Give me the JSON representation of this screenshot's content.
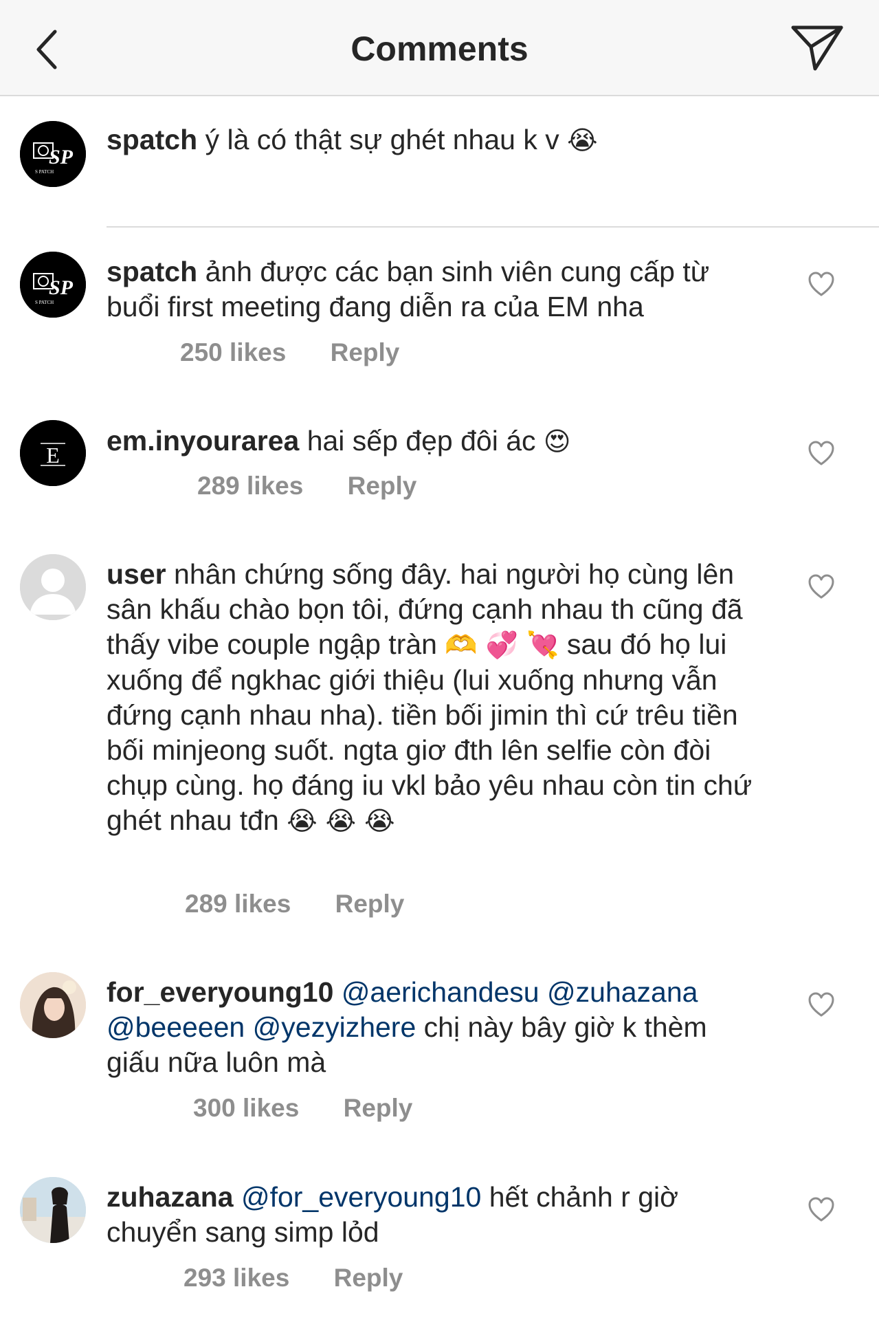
{
  "header": {
    "title": "Comments",
    "back_icon": "chevron-left-icon",
    "action_icon": "paper-plane-icon"
  },
  "caption": {
    "username": "spatch",
    "text": "ý là có thật sự ghét nhau k v",
    "emoji": "😭",
    "avatar_letters": "SP",
    "avatar_small": "S PATCH"
  },
  "comments": [
    {
      "username": "spatch",
      "text": "ảnh được các bạn sinh viên cung cấp từ buổi first meeting đang diễn ra của EM nha",
      "likes": "250 likes",
      "reply": "Reply",
      "avatar_letters": "SP",
      "avatar_small": "S PATCH"
    },
    {
      "username": "em.inyourarea",
      "text": "hai sếp đẹp đôi ác",
      "emoji": "😍",
      "likes": "289 likes",
      "reply": "Reply",
      "avatar_letter": "E"
    },
    {
      "username": "user",
      "text": "nhân chứng sống đây. hai người họ cùng lên sân khấu chào bọn tôi, đứng cạnh nhau th cũng đã thấy vibe couple ngập tràn",
      "emoji_a": "🫶 💞 💘",
      "text_b": "sau đó họ lui xuống để ngkhac giới thiệu (lui xuống nhưng vẫn đứng cạnh nhau nha). tiền bối jimin thì cứ trêu tiền bối minjeong suốt. ngta giơ đth lên selfie còn đòi chụp cùng. họ đáng iu vkl bảo yêu nhau còn tin chứ ghét nhau tđn",
      "emoji_b": "😭 😭 😭",
      "likes": "289 likes",
      "reply": "Reply"
    },
    {
      "username": "for_everyoung10",
      "mentions": [
        "@aerichandesu",
        "@zuhazana",
        "@beeeeen",
        "@yezyizhere"
      ],
      "text": "chị này bây giờ k thèm giấu nữa luôn mà",
      "likes": "300 likes",
      "reply": "Reply"
    },
    {
      "username": "zuhazana",
      "mentions": [
        "@for_everyoung10"
      ],
      "text": "hết chảnh r giờ chuyển sang simp lỏd",
      "likes": "293 likes",
      "reply": "Reply"
    }
  ],
  "colors": {
    "text": "#262626",
    "secondary": "#8e8e8e",
    "mention": "#003569",
    "header_bg": "#f7f7f7",
    "divider": "#dbdbdb"
  }
}
